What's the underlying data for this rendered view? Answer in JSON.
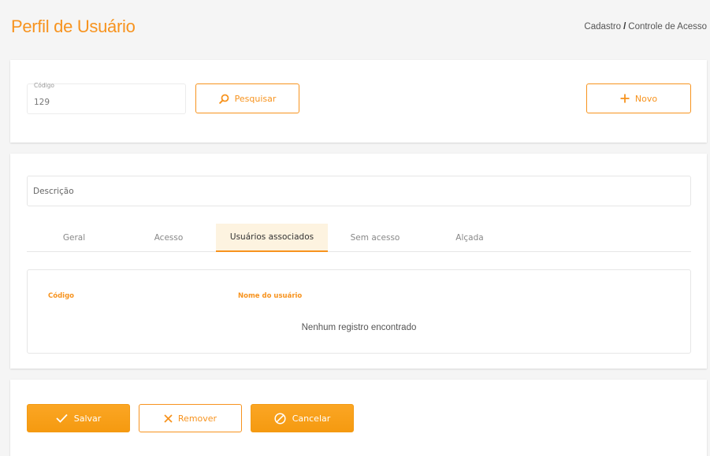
{
  "header": {
    "title": "Perfil de Usuário",
    "breadcrumb": {
      "parent": "Cadastro",
      "separator": "/",
      "current": "Controle de Acesso"
    }
  },
  "search_card": {
    "code_label": "Código",
    "code_value": "129",
    "search_button": "Pesquisar",
    "new_button": "Novo"
  },
  "main_card": {
    "description_placeholder": "Descrição",
    "tabs": [
      {
        "label": "Geral"
      },
      {
        "label": "Acesso"
      },
      {
        "label": "Usuários associados"
      },
      {
        "label": "Sem acesso"
      },
      {
        "label": "Alçada"
      }
    ],
    "active_tab": "Usuários associados",
    "table": {
      "columns": [
        "Código",
        "Nome do usuário"
      ],
      "empty_message": "Nenhum registro encontrado"
    }
  },
  "actions": {
    "save": "Salvar",
    "remove": "Remover",
    "cancel": "Cancelar"
  },
  "icons": {
    "search": "search-icon",
    "new": "plus-icon",
    "save": "check-icon",
    "remove": "close-icon",
    "cancel": "ban-icon"
  },
  "colors": {
    "accent": "#f7931e",
    "active_tab_bg": "#fdf3e0",
    "background": "#f5f5f5"
  }
}
